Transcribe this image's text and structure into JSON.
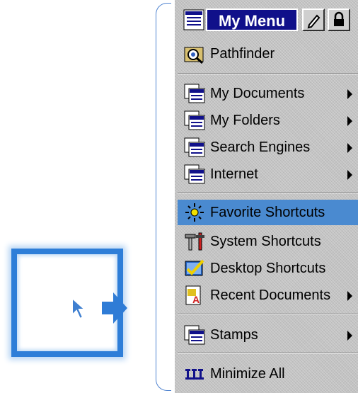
{
  "menu": {
    "title": "My Menu",
    "items": [
      {
        "label": "Pathfinder",
        "icon": "pathfinder-icon",
        "submenu": false
      },
      {
        "label": "My Documents",
        "icon": "folder-window-icon",
        "submenu": true
      },
      {
        "label": "My Folders",
        "icon": "folder-window-icon",
        "submenu": true
      },
      {
        "label": "Search Engines",
        "icon": "folder-window-icon",
        "submenu": true
      },
      {
        "label": "Internet",
        "icon": "folder-window-icon",
        "submenu": true
      },
      {
        "label": "Favorite Shortcuts",
        "icon": "sun-icon",
        "submenu": false,
        "highlighted": true
      },
      {
        "label": "System Shortcuts",
        "icon": "tools-icon",
        "submenu": false
      },
      {
        "label": "Desktop Shortcuts",
        "icon": "desktop-check-icon",
        "submenu": false
      },
      {
        "label": "Recent Documents",
        "icon": "recent-doc-icon",
        "submenu": true
      },
      {
        "label": "Stamps",
        "icon": "folder-window-icon",
        "submenu": true
      },
      {
        "label": "Minimize All",
        "icon": "minimize-all-icon",
        "submenu": false
      }
    ]
  },
  "colors": {
    "title_bg": "#10108a",
    "highlight": "#4a8ad0",
    "menu_bg": "#c3c3c3",
    "frame_accent": "#2e7ed8"
  }
}
